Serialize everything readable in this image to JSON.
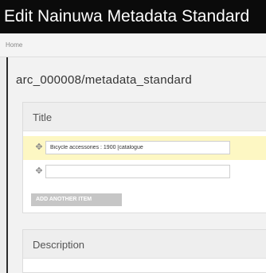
{
  "window": {
    "title": "Edit Nainuwa Metadata Standard"
  },
  "breadcrumb": {
    "home": "Home"
  },
  "page": {
    "title": "arc_000008/metadata_standard"
  },
  "title_field": {
    "label": "Title",
    "items": [
      {
        "value": "Bicycle accessories : 1900 [catalogue",
        "highlighted": true
      },
      {
        "value": "",
        "highlighted": false
      }
    ],
    "add_button": "ADD ANOTHER ITEM"
  },
  "description_field": {
    "label": "Description"
  },
  "icons": {
    "drag_handle": "drag-handle-icon"
  },
  "colors": {
    "titlebar": "#0b0b0b",
    "highlight_row": "#fdf7c3",
    "add_button": "#c6c6c6"
  }
}
